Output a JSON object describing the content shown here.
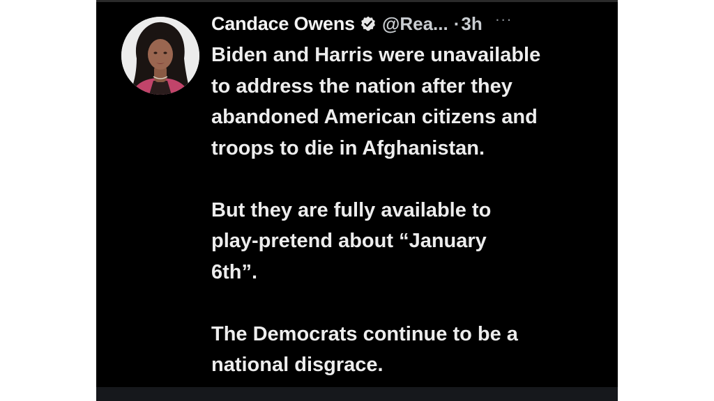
{
  "tweet": {
    "author_name": "Candace Owens",
    "handle": "@Rea...",
    "separator": "·",
    "time": "3h",
    "more_label": "···",
    "verified_icon": "verified-badge-icon",
    "paragraphs": [
      "Biden and Harris were unavailable\nto address the nation after they\nabandoned American citizens and\ntroops to die in Afghanistan.",
      "But they are fully available to\nplay-pretend about “January\n6th”.",
      "The Democrats continue to be a\nnational disgrace."
    ]
  },
  "colors": {
    "background": "#000000",
    "text": "#ededed",
    "muted": "#c9cdd1",
    "frame_outer": "#ffffff"
  }
}
